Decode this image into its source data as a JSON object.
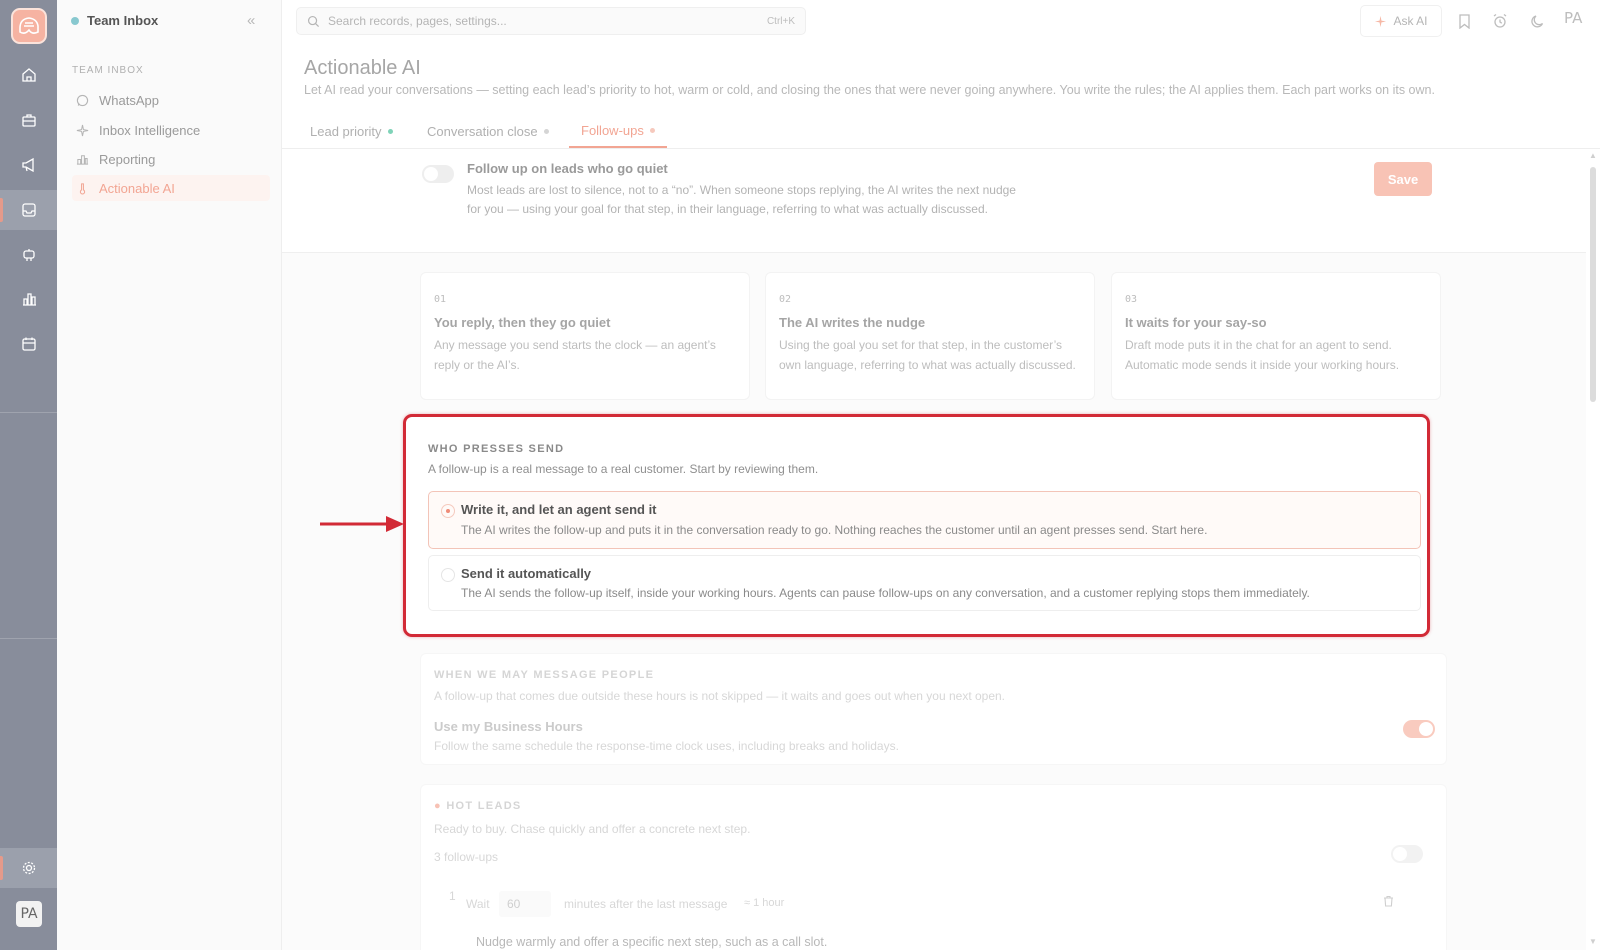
{
  "rail": {
    "logo_icon": "app-logo",
    "avatar": "PA",
    "icons": [
      "home-icon",
      "briefcase-icon",
      "megaphone-icon",
      "inbox-icon",
      "bot-icon",
      "bar-chart-icon",
      "calendar-icon",
      "settings-icon"
    ]
  },
  "sidebar": {
    "workspace": "Team Inbox",
    "section": "TEAM INBOX",
    "items": [
      {
        "label": "WhatsApp",
        "icon": "whatsapp-icon"
      },
      {
        "label": "Inbox Intelligence",
        "icon": "sparkles-icon"
      },
      {
        "label": "Reporting",
        "icon": "chart-icon"
      },
      {
        "label": "Actionable AI",
        "icon": "thermometer-icon",
        "active": true
      }
    ]
  },
  "topbar": {
    "search_placeholder": "Search records, pages, settings...",
    "shortcut": "Ctrl+K",
    "ask_ai": "Ask AI",
    "avatar": "PA"
  },
  "header": {
    "title": "Actionable AI",
    "description": "Let AI read your conversations — setting each lead’s priority to hot, warm or cold, and closing the ones that were never going anywhere. You write the rules; the AI applies them. Each part works on its own."
  },
  "tabs": [
    {
      "label": "Lead priority",
      "dot_color": "#7fd3b8"
    },
    {
      "label": "Conversation close",
      "dot_color": "#d5d5d5"
    },
    {
      "label": "Follow-ups",
      "dot_color": "#f6c9bd",
      "active": true
    }
  ],
  "followup_toggle": {
    "title": "Follow up on leads who go quiet",
    "description": "Most leads are lost to silence, not to a “no”. When someone stops replying, the AI writes the next nudge for you — using your goal for that step, in their language, referring to what was actually discussed.",
    "enabled": false,
    "save_label": "Save"
  },
  "steps": [
    {
      "num": "01",
      "title": "You reply, then they go quiet",
      "desc": "Any message you send starts the clock — an agent’s reply or the AI’s."
    },
    {
      "num": "02",
      "title": "The AI writes the nudge",
      "desc": "Using the goal you set for that step, in the customer’s own language, referring to what was actually discussed."
    },
    {
      "num": "03",
      "title": "It waits for your say-so",
      "desc": "Draft mode puts it in the chat for an agent to send. Automatic mode sends it inside your working hours."
    }
  ],
  "who_presses_send": {
    "label": "WHO PRESSES SEND",
    "description": "A follow-up is a real message to a real customer. Start by reviewing them.",
    "options": [
      {
        "title": "Write it, and let an agent send it",
        "desc": "The AI writes the follow-up and puts it in the conversation ready to go. Nothing reaches the customer until an agent presses send. Start here.",
        "selected": true
      },
      {
        "title": "Send it automatically",
        "desc": "The AI sends the follow-up itself, inside your working hours. Agents can pause follow-ups on any conversation, and a customer replying stops them immediately.",
        "selected": false
      }
    ]
  },
  "when_message": {
    "label": "WHEN WE MAY MESSAGE PEOPLE",
    "description": "A follow-up that comes due outside these hours is not skipped — it waits and goes out when you next open.",
    "setting_title": "Use my Business Hours",
    "setting_desc": "Follow the same schedule the response-time clock uses, including breaks and holidays.",
    "enabled": true
  },
  "hot_leads": {
    "label": "HOT LEADS",
    "description": "Ready to buy. Chase quickly and offer a concrete next step.",
    "count_text": "3 follow-ups",
    "step_number": "1",
    "wait_label": "Wait",
    "wait_value": "60",
    "wait_suffix": "minutes after the last message",
    "wait_hint": "≈ 1 hour",
    "goal": "Nudge warmly and offer a specific next step, such as a call slot."
  },
  "colors": {
    "accent": "#f2a593",
    "highlight_border": "#d22a36",
    "rail": "#888d9b"
  }
}
